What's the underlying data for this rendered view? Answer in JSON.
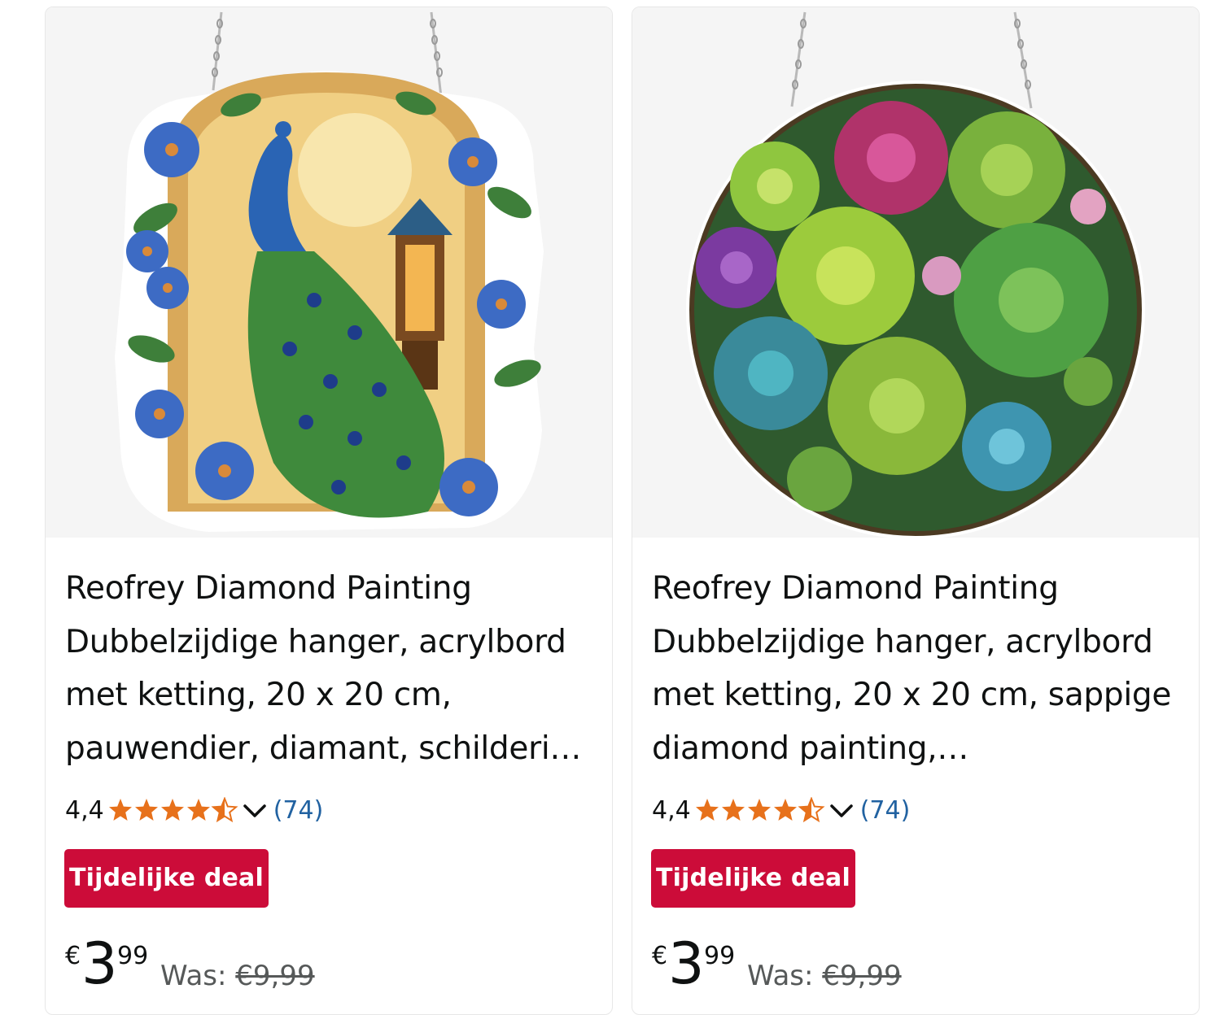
{
  "products": [
    {
      "image_alt": "peacock-lantern-acrylic-hanger",
      "title": "Reofrey Diamond Painting Dubbelzijdige hanger, acrylbord met ketting, 20 x 20 cm, pauwendier, diamant, schilderi…",
      "rating_value": "4,4",
      "stars": 4.5,
      "rating_count": "(74)",
      "deal_label": "Tijdelijke deal",
      "price_currency": "€",
      "price_whole": "3",
      "price_fraction": "99",
      "was_label": "Was:",
      "was_price": "€9,99"
    },
    {
      "image_alt": "succulents-round-acrylic-hanger",
      "title": "Reofrey Diamond Painting Dubbelzijdige hanger, acrylbord met ketting, 20 x 20 cm, sappige diamond painting,…",
      "rating_value": "4,4",
      "stars": 4.5,
      "rating_count": "(74)",
      "deal_label": "Tijdelijke deal",
      "price_currency": "€",
      "price_whole": "3",
      "price_fraction": "99",
      "was_label": "Was:",
      "was_price": "€9,99"
    }
  ],
  "colors": {
    "star": "#e7711b",
    "deal_badge": "#cc0c39",
    "link": "#2162a1",
    "text": "#0f1111",
    "muted": "#565959",
    "image_bg": "#f5f5f5"
  },
  "icons": {
    "rating_expand": "chevron-down-icon",
    "star_full": "star-full-icon",
    "star_half": "star-half-icon"
  }
}
